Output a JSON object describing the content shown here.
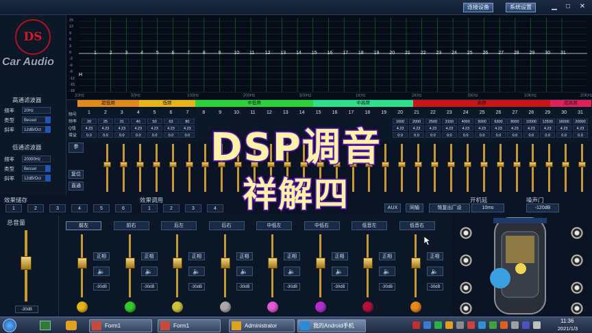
{
  "header": {
    "connect_label": "连接设备",
    "settings_label": "系统设置",
    "minimize": "▁",
    "maximize": "□",
    "close": "✕"
  },
  "logo": {
    "text": "DS",
    "brand": "Car Audio"
  },
  "filters": {
    "high": {
      "title": "高通滤波器",
      "freq_label": "频率",
      "freq": "20Hz",
      "type_label": "类型",
      "type": "Bessel",
      "slope_label": "斜率",
      "slope": "12dB/Oct"
    },
    "low": {
      "title": "低通滤波器",
      "freq_label": "频率",
      "freq": "20000Hz",
      "type_label": "类型",
      "type": "Bessel",
      "slope_label": "斜率",
      "slope": "12dB/Oct"
    }
  },
  "graph": {
    "y_ticks": [
      "15",
      "12",
      "9",
      "6",
      "3",
      "0",
      "-3",
      "-6",
      "-9",
      "-12",
      "-15",
      "-18"
    ],
    "x_ticks": [
      "20Hz",
      "50Hz",
      "100Hz",
      "200Hz",
      "500Hz",
      "1KHz",
      "2KHz",
      "5KHz",
      "10KHz",
      "20KHz"
    ],
    "band_points": [
      "1",
      "2",
      "3",
      "4",
      "5",
      "6",
      "7",
      "8",
      "9",
      "10",
      "11",
      "12",
      "13",
      "14",
      "15",
      "16",
      "17",
      "18",
      "19",
      "20",
      "21",
      "22",
      "23",
      "24",
      "25",
      "26",
      "27",
      "28",
      "29",
      "30",
      "31"
    ],
    "marker": "H"
  },
  "bands": [
    {
      "label": "超低频",
      "color": "#e08a1e"
    },
    {
      "label": "低频",
      "color": "#e7b51b"
    },
    {
      "label": "中低频",
      "color": "#2fd13a"
    },
    {
      "label": "中高频",
      "color": "#2fe08a"
    },
    {
      "label": "高频",
      "color": "#c91515"
    },
    {
      "label": "超高频",
      "color": "#e0205a"
    }
  ],
  "eq": {
    "row_labels": [
      "频号",
      "频率",
      "Q值",
      "增益"
    ],
    "numbers": [
      "1",
      "2",
      "3",
      "4",
      "5",
      "6",
      "7",
      "8",
      "9",
      "10",
      "11",
      "12",
      "13",
      "14",
      "15",
      "16",
      "17",
      "18",
      "19",
      "20",
      "21",
      "22",
      "23",
      "24",
      "25",
      "26",
      "27",
      "28",
      "29",
      "30",
      "31"
    ],
    "freqs": [
      "20",
      "25",
      "31",
      "40",
      "50",
      "63",
      "80",
      "",
      "",
      "",
      "",
      "",
      "",
      "",
      "",
      "",
      "",
      "1600",
      "2000",
      "2500",
      "3150",
      "4000",
      "5000",
      "6300",
      "8000",
      "10000",
      "12500",
      "16000",
      "20000"
    ],
    "q": [
      "4.23",
      "4.23",
      "4.23",
      "4.23",
      "4.23",
      "4.23",
      "4.23",
      "",
      "",
      "",
      "",
      "",
      "",
      "",
      "",
      "",
      "",
      "4.23",
      "4.23",
      "4.23",
      "4.23",
      "4.23",
      "4.23",
      "4.23",
      "4.23",
      "4.23",
      "4.23",
      "4.23",
      "4.23"
    ],
    "gain": [
      "0.0",
      "0.0",
      "0.0",
      "0.0",
      "0.0",
      "0.0",
      "0.0",
      "",
      "",
      "",
      "",
      "",
      "",
      "",
      "",
      "",
      "",
      "0.0",
      "0.0",
      "0.0",
      "0.0",
      "0.0",
      "0.0",
      "0.0",
      "0.0",
      "0.0",
      "0.0",
      "0.0",
      "0.0"
    ],
    "side_buttons": [
      "参",
      "复位",
      "直通"
    ]
  },
  "presets": {
    "save_title": "效果储存",
    "save_buttons": [
      "1",
      "2",
      "3",
      "4",
      "5",
      "6"
    ],
    "recall_title": "效果调用",
    "recall_buttons": [
      "1",
      "2",
      "3",
      "4"
    ],
    "aux_label": "AUX",
    "sync_label": "同轴",
    "restore_label": "恢复出厂设",
    "power_delay_label": "开机延",
    "power_delay_value": "10ms",
    "noise_gate_label": "噪声门",
    "noise_gate_value": "-120dB"
  },
  "master": {
    "title": "总音量",
    "value": "-30dB"
  },
  "channels": [
    {
      "name": "前左",
      "phase": "正相",
      "db": "-30dB",
      "color": "#e6b21b",
      "active": true
    },
    {
      "name": "前右",
      "phase": "正相",
      "db": "-30dB",
      "color": "#35c82e"
    },
    {
      "name": "后左",
      "phase": "正相",
      "db": "-30dB",
      "color": "#cfc23a"
    },
    {
      "name": "后右",
      "phase": "正相",
      "db": "-30dB",
      "color": "#a8a8a8"
    },
    {
      "name": "中低左",
      "phase": "正相",
      "db": "-30dB",
      "color": "#e05ad2"
    },
    {
      "name": "中低右",
      "phase": "正相",
      "db": "-30dB",
      "color": "#b02fd0"
    },
    {
      "name": "低音左",
      "phase": "正相",
      "db": "-30dB",
      "color": "#b4103a"
    },
    {
      "name": "低音右",
      "phase": "正相",
      "db": "-30dB",
      "color": "#e8871a"
    }
  ],
  "mute_icon": "🔈",
  "overlay": {
    "line1": "DSP调音",
    "line2": "祥解四"
  },
  "taskbar": {
    "items": [
      "Form1",
      "Form1",
      "Administrator",
      "我的Android手机"
    ],
    "time": "11:36",
    "date": "2021/1/3"
  }
}
